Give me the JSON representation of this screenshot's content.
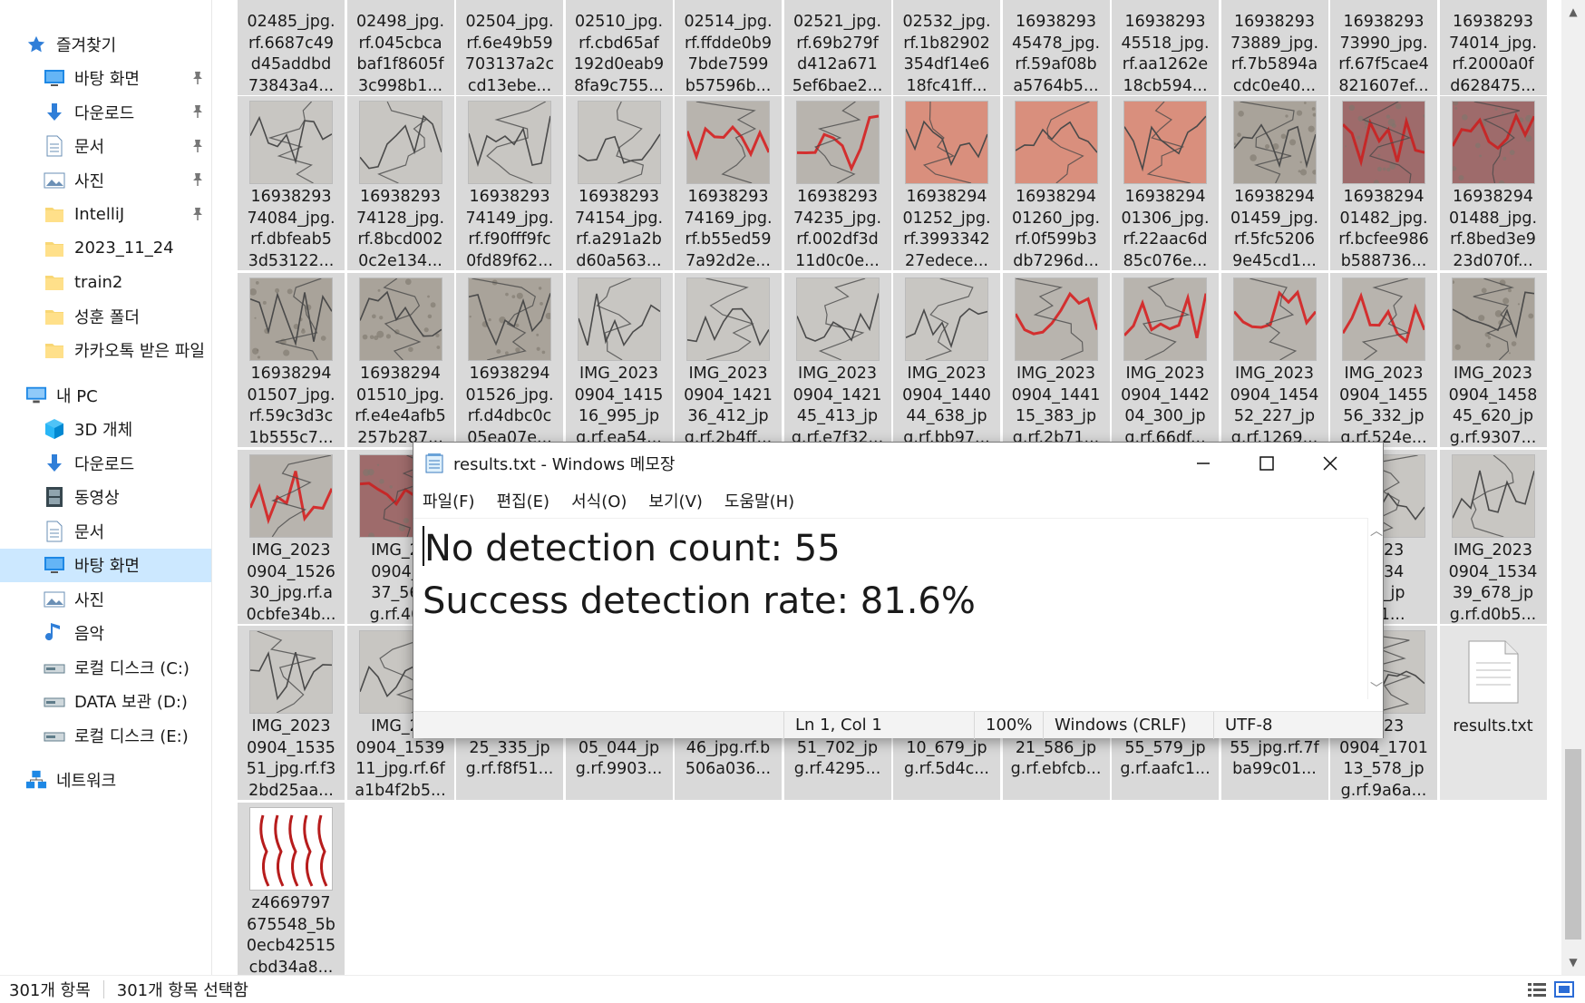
{
  "nav": {
    "items": [
      {
        "label": "즐겨찾기",
        "icon": "star-icon",
        "pinned": false,
        "indent": 0
      },
      {
        "label": "바탕 화면",
        "icon": "desktop-icon",
        "pinned": true,
        "indent": 1
      },
      {
        "label": "다운로드",
        "icon": "download-icon",
        "pinned": true,
        "indent": 1
      },
      {
        "label": "문서",
        "icon": "document-icon",
        "pinned": true,
        "indent": 1
      },
      {
        "label": "사진",
        "icon": "pictures-icon",
        "pinned": true,
        "indent": 1
      },
      {
        "label": "IntelliJ",
        "icon": "folder-icon",
        "pinned": true,
        "indent": 1
      },
      {
        "label": "2023_11_24",
        "icon": "folder-icon",
        "pinned": false,
        "indent": 1
      },
      {
        "label": "train2",
        "icon": "folder-icon",
        "pinned": false,
        "indent": 1
      },
      {
        "label": "성훈 폴더",
        "icon": "folder-icon",
        "pinned": false,
        "indent": 1
      },
      {
        "label": "카카오톡 받은 파일",
        "icon": "folder-icon",
        "pinned": false,
        "indent": 1
      },
      {
        "label": "내 PC",
        "icon": "pc-icon",
        "pinned": false,
        "indent": 0
      },
      {
        "label": "3D 개체",
        "icon": "cube-icon",
        "pinned": false,
        "indent": 1
      },
      {
        "label": "다운로드",
        "icon": "download-icon",
        "pinned": false,
        "indent": 1
      },
      {
        "label": "동영상",
        "icon": "video-icon",
        "pinned": false,
        "indent": 1
      },
      {
        "label": "문서",
        "icon": "document-icon",
        "pinned": false,
        "indent": 1
      },
      {
        "label": "바탕 화면",
        "icon": "desktop-icon",
        "pinned": false,
        "indent": 1,
        "selected": true
      },
      {
        "label": "사진",
        "icon": "pictures-icon",
        "pinned": false,
        "indent": 1
      },
      {
        "label": "음악",
        "icon": "music-icon",
        "pinned": false,
        "indent": 1
      },
      {
        "label": "로컬 디스크 (C:)",
        "icon": "drive-icon",
        "pinned": false,
        "indent": 1
      },
      {
        "label": "DATA 보관 (D:)",
        "icon": "drive-icon",
        "pinned": false,
        "indent": 1
      },
      {
        "label": "로컬 디스크 (E:)",
        "icon": "drive-icon",
        "pinned": false,
        "indent": 1
      },
      {
        "label": "네트워크",
        "icon": "network-icon",
        "pinned": false,
        "indent": 0
      }
    ]
  },
  "files": [
    {
      "lines": [
        "02485_jpg.",
        "rf.6687c49",
        "d45addbd",
        "73843a4..."
      ],
      "thumb": "none"
    },
    {
      "lines": [
        "02498_jpg.",
        "rf.045cbca",
        "baf1f8605f",
        "3c998b1..."
      ],
      "thumb": "none"
    },
    {
      "lines": [
        "02504_jpg.",
        "rf.6e49b59",
        "703137a2c",
        "cd13ebe..."
      ],
      "thumb": "none"
    },
    {
      "lines": [
        "02510_jpg.",
        "rf.cbd65af",
        "192d0eab9",
        "8fa9c755..."
      ],
      "thumb": "none"
    },
    {
      "lines": [
        "02514_jpg.",
        "rf.ffdde0b9",
        "7bde7599",
        "b57596b..."
      ],
      "thumb": "none"
    },
    {
      "lines": [
        "02521_jpg.",
        "rf.69b279f",
        "d412a671",
        "5ef6bae2..."
      ],
      "thumb": "none"
    },
    {
      "lines": [
        "02532_jpg.",
        "rf.1b82902",
        "354df14e6",
        "18fc41ff..."
      ],
      "thumb": "none"
    },
    {
      "lines": [
        "16938293",
        "45478_jpg.",
        "rf.59af08b",
        "a5764b5..."
      ],
      "thumb": "none"
    },
    {
      "lines": [
        "16938293",
        "45518_jpg.",
        "rf.aa1262e",
        "18cb594..."
      ],
      "thumb": "none"
    },
    {
      "lines": [
        "16938293",
        "73889_jpg.",
        "rf.7b5894a",
        "cdc0e40..."
      ],
      "thumb": "none"
    },
    {
      "lines": [
        "16938293",
        "73990_jpg.",
        "rf.67f5cae4",
        "821607ef..."
      ],
      "thumb": "none"
    },
    {
      "lines": [
        "16938293",
        "74014_jpg.",
        "rf.2000a0f",
        "d628475..."
      ],
      "thumb": "none"
    },
    {
      "lines": [
        "16938293",
        "74084_jpg.",
        "rf.dbfeab5",
        "3d53122..."
      ],
      "thumb": "gray"
    },
    {
      "lines": [
        "16938293",
        "74128_jpg.",
        "rf.8bcd002",
        "0c2e134..."
      ],
      "thumb": "gray"
    },
    {
      "lines": [
        "16938293",
        "74149_jpg.",
        "rf.f90fff9fc",
        "0fd89f62..."
      ],
      "thumb": "gray"
    },
    {
      "lines": [
        "16938293",
        "74154_jpg.",
        "rf.a291a2b",
        "d60a563..."
      ],
      "thumb": "gray"
    },
    {
      "lines": [
        "16938293",
        "74169_jpg.",
        "rf.b55ed59",
        "7a92d2e..."
      ],
      "thumb": "redline"
    },
    {
      "lines": [
        "16938293",
        "74235_jpg.",
        "rf.002df3d",
        "11d0c0e..."
      ],
      "thumb": "redline"
    },
    {
      "lines": [
        "16938294",
        "01252_jpg.",
        "rf.3993342",
        "27edece..."
      ],
      "thumb": "pink"
    },
    {
      "lines": [
        "16938294",
        "01260_jpg.",
        "rf.0f599b3",
        "db7296d..."
      ],
      "thumb": "pink"
    },
    {
      "lines": [
        "16938294",
        "01306_jpg.",
        "rf.22aac6d",
        "85c076e..."
      ],
      "thumb": "pink"
    },
    {
      "lines": [
        "16938294",
        "01459_jpg.",
        "rf.5fc5206",
        "9e45cd1..."
      ],
      "thumb": "stone"
    },
    {
      "lines": [
        "16938294",
        "01482_jpg.",
        "rf.bcfee986",
        "b588736..."
      ],
      "thumb": "redstone"
    },
    {
      "lines": [
        "16938294",
        "01488_jpg.",
        "rf.8bed3e9",
        "23d070f..."
      ],
      "thumb": "redstone"
    },
    {
      "lines": [
        "16938294",
        "01507_jpg.",
        "rf.59c3d3c",
        "1b555c7..."
      ],
      "thumb": "stone"
    },
    {
      "lines": [
        "16938294",
        "01510_jpg.",
        "rf.e4e4afb5",
        "257b287..."
      ],
      "thumb": "stone"
    },
    {
      "lines": [
        "16938294",
        "01526_jpg.",
        "rf.d4dbc0c",
        "05ea07e..."
      ],
      "thumb": "stone"
    },
    {
      "lines": [
        "IMG_2023",
        "0904_1415",
        "16_995_jp",
        "g.rf.ea54..."
      ],
      "thumb": "gray"
    },
    {
      "lines": [
        "IMG_2023",
        "0904_1421",
        "36_412_jp",
        "g.rf.2b4ff..."
      ],
      "thumb": "gray"
    },
    {
      "lines": [
        "IMG_2023",
        "0904_1421",
        "45_413_jp",
        "g.rf.e7f32..."
      ],
      "thumb": "gray"
    },
    {
      "lines": [
        "IMG_2023",
        "0904_1440",
        "44_638_jp",
        "g.rf.bb97..."
      ],
      "thumb": "gray"
    },
    {
      "lines": [
        "IMG_2023",
        "0904_1441",
        "15_383_jp",
        "g.rf.2b71..."
      ],
      "thumb": "redline"
    },
    {
      "lines": [
        "IMG_2023",
        "0904_1442",
        "04_300_jp",
        "g.rf.66df..."
      ],
      "thumb": "redline"
    },
    {
      "lines": [
        "IMG_2023",
        "0904_1454",
        "52_227_jp",
        "g.rf.1269..."
      ],
      "thumb": "redline"
    },
    {
      "lines": [
        "IMG_2023",
        "0904_1455",
        "56_332_jp",
        "g.rf.524e..."
      ],
      "thumb": "redline"
    },
    {
      "lines": [
        "IMG_2023",
        "0904_1458",
        "45_620_jp",
        "g.rf.9307..."
      ],
      "thumb": "stone"
    },
    {
      "lines": [
        "IMG_2023",
        "0904_1526",
        "30_jpg.rf.a",
        "0cbfe34b..."
      ],
      "thumb": "redline"
    },
    {
      "lines": [
        "IMG_20",
        "0904_1",
        "37_568",
        "g.rf.402"
      ],
      "thumb": "redstone"
    },
    {
      "lines": [
        "",
        "",
        "",
        ""
      ],
      "thumb": "none",
      "hidden": true
    },
    {
      "lines": [
        "",
        "",
        "",
        ""
      ],
      "thumb": "none",
      "hidden": true
    },
    {
      "lines": [
        "",
        "",
        "",
        ""
      ],
      "thumb": "none",
      "hidden": true
    },
    {
      "lines": [
        "",
        "",
        "",
        ""
      ],
      "thumb": "none",
      "hidden": true
    },
    {
      "lines": [
        "",
        "",
        "",
        ""
      ],
      "thumb": "none",
      "hidden": true
    },
    {
      "lines": [
        "",
        "",
        "",
        ""
      ],
      "thumb": "none",
      "hidden": true
    },
    {
      "lines": [
        "",
        "",
        "",
        ""
      ],
      "thumb": "none",
      "hidden": true
    },
    {
      "lines": [
        "",
        "",
        "",
        ""
      ],
      "thumb": "none",
      "hidden": true
    },
    {
      "lines": [
        "2023",
        "1534",
        "90_jp",
        "cc1..."
      ],
      "thumb": "gray"
    },
    {
      "lines": [
        "IMG_2023",
        "0904_1534",
        "39_678_jp",
        "g.rf.d0b5..."
      ],
      "thumb": "gray"
    },
    {
      "lines": [
        "IMG_2023",
        "0904_1535",
        "51_jpg.rf.f3",
        "2bd25aa..."
      ],
      "thumb": "gray"
    },
    {
      "lines": [
        "IMG_20",
        "0904_1539",
        "11_jpg.rf.6f",
        "a1b4f2b5..."
      ],
      "thumb": "gray"
    },
    {
      "lines": [
        "",
        "0904_1612",
        "25_335_jp",
        "g.rf.f8f51..."
      ],
      "thumb": "none"
    },
    {
      "lines": [
        "",
        "0904_1614",
        "05_044_jp",
        "g.rf.9903..."
      ],
      "thumb": "none"
    },
    {
      "lines": [
        "",
        "0904_1647",
        "46_jpg.rf.b",
        "506a036..."
      ],
      "thumb": "none"
    },
    {
      "lines": [
        "",
        "0904_1648",
        "51_702_jp",
        "g.rf.4295..."
      ],
      "thumb": "none"
    },
    {
      "lines": [
        "",
        "0904_1649",
        "10_679_jp",
        "g.rf.5d4c..."
      ],
      "thumb": "none"
    },
    {
      "lines": [
        "",
        "0904_1650",
        "21_586_jp",
        "g.rf.ebfcb..."
      ],
      "thumb": "none"
    },
    {
      "lines": [
        "",
        "0904_1651",
        "55_579_jp",
        "g.rf.aafc1..."
      ],
      "thumb": "none"
    },
    {
      "lines": [
        "",
        "0904_1651",
        "55_jpg.rf.7f",
        "ba99c01..."
      ],
      "thumb": "none"
    },
    {
      "lines": [
        "2023",
        "0904_1701",
        "13_578_jp",
        "g.rf.9a6a..."
      ],
      "thumb": "gray"
    },
    {
      "lines": [
        "results.txt"
      ],
      "thumb": "txt"
    },
    {
      "lines": [
        "z4669797",
        "675548_5b",
        "0ecb42515",
        "cbd34a8..."
      ],
      "thumb": "redtrees"
    }
  ],
  "status": {
    "count": "301개 항목",
    "selected": "301개 항목 선택함"
  },
  "notepad": {
    "title": "results.txt - Windows 메모장",
    "menu": [
      "파일(F)",
      "편집(E)",
      "서식(O)",
      "보기(V)",
      "도움말(H)"
    ],
    "lines": [
      "No detection count: 55",
      "Success detection rate: 81.6%"
    ],
    "status_pos": "Ln 1, Col 1",
    "status_zoom": "100%",
    "status_eol": "Windows (CRLF)",
    "status_enc": "UTF-8"
  }
}
